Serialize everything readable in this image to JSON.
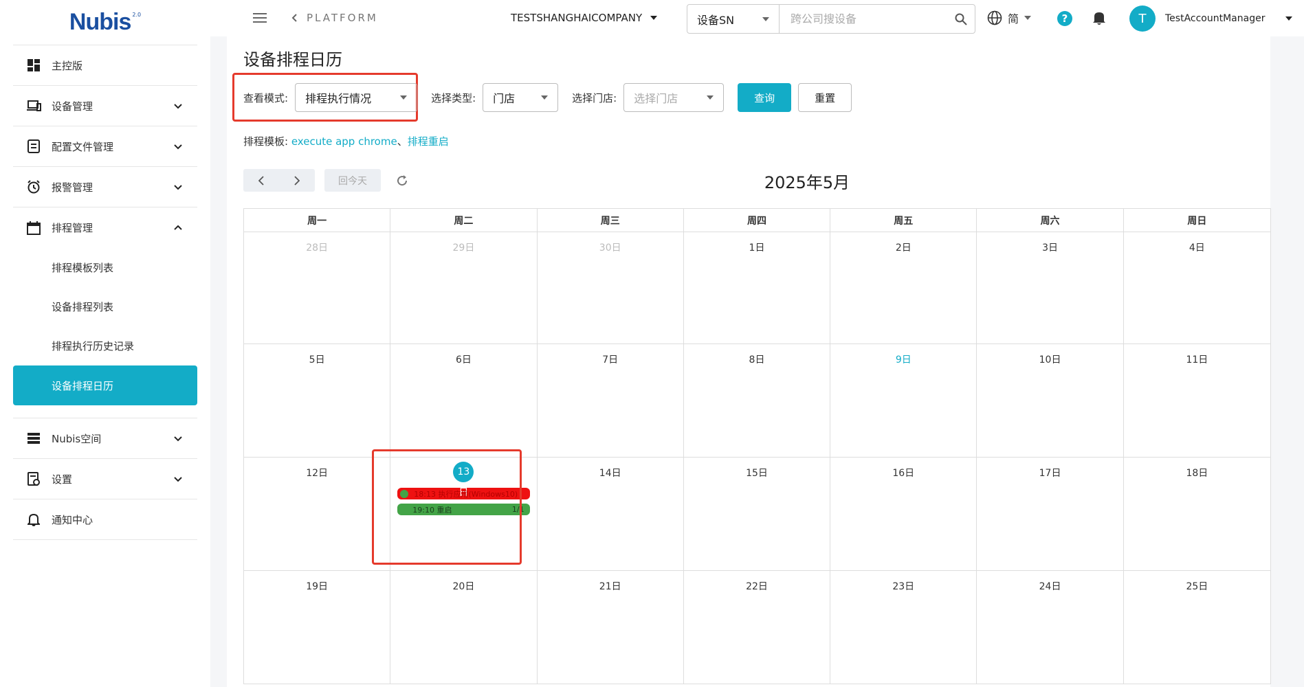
{
  "sidebar": {
    "logo_text": "Nubis",
    "logo_sup": "2.0",
    "items": [
      {
        "label": "主控版",
        "icon": "dashboard-icon"
      },
      {
        "label": "设备管理",
        "icon": "devices-icon"
      },
      {
        "label": "配置文件管理",
        "icon": "config-file-icon"
      },
      {
        "label": "报警管理",
        "icon": "alarm-icon"
      },
      {
        "label": "排程管理",
        "icon": "calendar-icon"
      },
      {
        "label": "Nubis空间",
        "icon": "storage-icon"
      },
      {
        "label": "设置",
        "icon": "settings-icon"
      },
      {
        "label": "通知中心",
        "icon": "bell-icon"
      }
    ],
    "sub_items": [
      "排程模板列表",
      "设备排程列表",
      "排程执行历史记录",
      "设备排程日历"
    ]
  },
  "header": {
    "platform_label": "PLATFORM",
    "company": "TESTSHANGHAICOMPANY",
    "search_type": "设备SN",
    "search_placeholder": "跨公司搜设备",
    "language": "简",
    "help": "?",
    "avatar_letter": "T",
    "username": "TestAccountManager"
  },
  "main": {
    "title": "设备排程日历",
    "view_mode_label": "查看模式:",
    "view_mode_value": "排程执行情况",
    "type_label": "选择类型:",
    "type_value": "门店",
    "store_label": "选择门店:",
    "store_placeholder": "选择门店",
    "query_button": "查询",
    "reset_button": "重置",
    "template_label": "排程模板:",
    "template_links": [
      "execute app chrome",
      "排程重启"
    ],
    "template_sep": "、",
    "today_button": "回今天",
    "month_title": "2025年5月"
  },
  "calendar": {
    "weekdays": [
      "周一",
      "周二",
      "周三",
      "周四",
      "周五",
      "周六",
      "周日"
    ],
    "weeks": [
      [
        "28日",
        "29日",
        "30日",
        "1日",
        "2日",
        "3日",
        "4日"
      ],
      [
        "5日",
        "6日",
        "7日",
        "8日",
        "9日",
        "10日",
        "11日"
      ],
      [
        "12日",
        "13日",
        "14日",
        "15日",
        "16日",
        "17日",
        "18日"
      ],
      [
        "19日",
        "20日",
        "21日",
        "22日",
        "23日",
        "24日",
        "25日"
      ]
    ],
    "events": [
      {
        "text": "18:13  执行应用(Windows10)",
        "color": "#ee1111"
      },
      {
        "text": "19:10  重启",
        "count": "1/1",
        "color": "#43a447"
      }
    ]
  },
  "colors": {
    "accent": "#13acc7",
    "highlight": "#e53a2c"
  }
}
